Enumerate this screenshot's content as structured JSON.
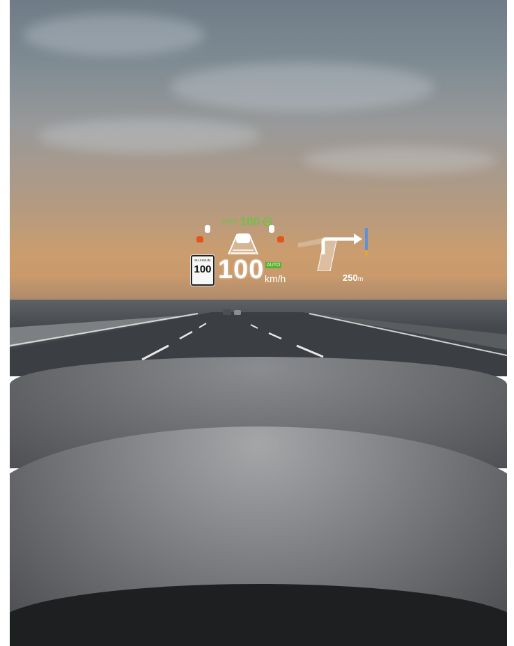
{
  "hud": {
    "assist_label": "HDA",
    "set_speed": "100",
    "speed_limit_caption": "MAXIMUM",
    "speed_limit": "100",
    "speed": "100",
    "cruise_mode": "AUTO",
    "speed_unit": "km/h",
    "nav_distance": "250",
    "nav_distance_unit": "m"
  },
  "colors": {
    "hud_green": "#6fc04a",
    "hud_white": "#ffffff",
    "hud_orange": "#e2551c",
    "nav_blue": "#5b8fe0"
  },
  "icons": [
    "steering-wheel-icon",
    "car-icon",
    "lane-icon",
    "turn-right-arrow-icon"
  ]
}
